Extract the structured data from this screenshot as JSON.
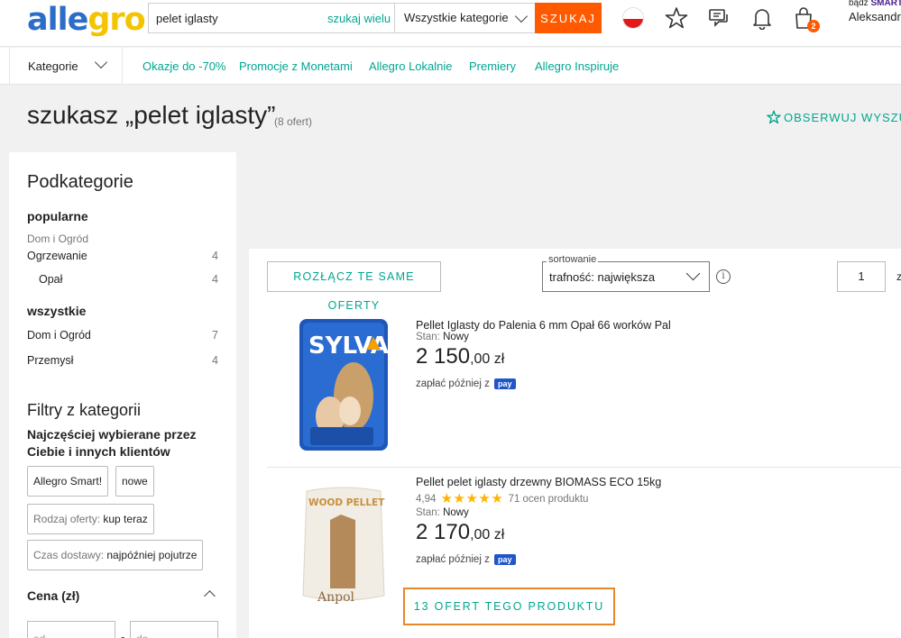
{
  "header": {
    "logo_part1": "alle",
    "logo_part2": "gro",
    "search_value": "pelet iglasty",
    "search_many_label": "szukaj wielu",
    "category_select": "Wszystkie kategorie",
    "search_button": "SZUKAJ",
    "cart_count": "2",
    "smart_prefix": "bądź ",
    "smart_brand": "SMART",
    "user_name": "Aleksandra"
  },
  "nav": {
    "categories_label": "Kategorie",
    "links": [
      "Okazje do -70%",
      "Promocje z Monetami",
      "Allegro Lokalnie",
      "Premiery",
      "Allegro Inspiruje"
    ]
  },
  "page": {
    "title": "szukasz „pelet iglasty”",
    "count": "(8 ofert)",
    "watch_label": "OBSERWUJ WYSZUKI"
  },
  "sidebar": {
    "subcategories_heading": "Podkategorie",
    "popular_heading": "popularne",
    "popular_parent": "Dom i Ogród",
    "popular_items": [
      {
        "label": "Ogrzewanie",
        "count": "4"
      },
      {
        "label": "Opał",
        "count": "4"
      }
    ],
    "all_heading": "wszystkie",
    "all_items": [
      {
        "label": "Dom i Ogród",
        "count": "7"
      },
      {
        "label": "Przemysł",
        "count": "4"
      }
    ],
    "filters_heading": "Filtry z kategorii",
    "filters_desc": "Najczęściej wybierane przez Ciebie i innych klientów",
    "chip_smart": "Allegro Smart!",
    "chip_new": "nowe",
    "chip_type_label": "Rodzaj oferty: ",
    "chip_type_value": "kup teraz",
    "chip_delivery_label": "Czas dostawy: ",
    "chip_delivery_value": "najpóźniej pojutrze",
    "price_heading": "Cena (zł)",
    "price_from_placeholder": "od",
    "price_to_placeholder": "do"
  },
  "results": {
    "split_button": "ROZŁĄCZ TE SAME OFERTY",
    "sort_label": "sortowanie",
    "sort_value": "trafność: największa",
    "page_number": "1",
    "page_suffix": "z",
    "offers": [
      {
        "title": "Pellet Iglasty do Palenia 6 mm Opał 66 worków Pal",
        "condition_label": "Stan: ",
        "condition_value": "Nowy",
        "price_main": "2 150",
        "price_fraction": ",00 zł",
        "pay_later": "zapłać później z",
        "pay_badge": "pay",
        "image_text": "SYLVA"
      },
      {
        "title": "Pellet pelet iglasty drzewny BIOMASS ECO 15kg",
        "rating_value": "4,94",
        "rating_stars": 5,
        "rating_count": "71 ocen produktu",
        "condition_label": "Stan: ",
        "condition_value": "Nowy",
        "price_main": "2 170",
        "price_fraction": ",00 zł",
        "pay_later": "zapłać później z",
        "pay_badge": "pay",
        "image_text": "WOOD PELLET",
        "image_brand": "Anpol",
        "offers_button": "13 OFERT TEGO PRODUKTU"
      }
    ]
  },
  "colors": {
    "accent_teal": "#00a790",
    "search_orange": "#ff5a00",
    "highlight_border": "#e8862a",
    "logo_blue": "#2b6dc9",
    "logo_yellow": "#f4c400"
  }
}
